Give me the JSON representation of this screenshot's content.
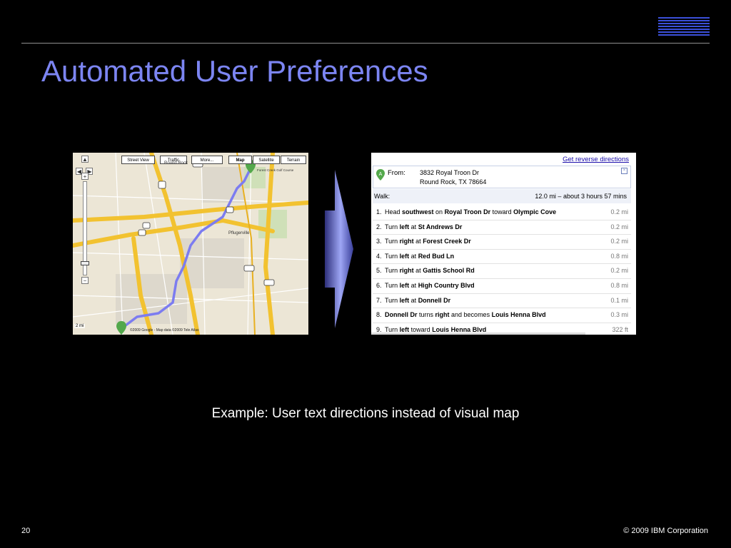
{
  "slide": {
    "title": "Automated User Preferences",
    "caption": "Example:  User text directions instead of visual map",
    "page_number": "20",
    "copyright": "© 2009 IBM Corporation"
  },
  "logo": {
    "text": "IBM",
    "color": "#3b4fd9"
  },
  "map": {
    "buttons": [
      "Street View",
      "Traffic",
      "More...",
      "Map",
      "Satellite",
      "Terrain"
    ],
    "zoom_in": "+",
    "zoom_out": "−",
    "scale": "2 mi",
    "copyright": "©2009 Google - Map data ©2009 Tele Atlas",
    "labels": [
      "Round Rock",
      "Pflugerville",
      "Forest Creek Golf Course"
    ],
    "highway_shields": [
      "79",
      "35",
      "45",
      "1",
      "130",
      "685",
      "45"
    ]
  },
  "directions": {
    "reverse_link": "Get reverse directions",
    "from_label": "From:",
    "address_line1": "3832 Royal Troon Dr",
    "address_line2": "Round Rock, TX 78664",
    "mode_label": "Walk:",
    "summary": "12.0 mi – about 3 hours 57 mins",
    "steps": [
      {
        "num": "1.",
        "pre": "Head ",
        "b1": "southwest",
        "mid": " on ",
        "b2": "Royal Troon Dr",
        "mid2": " toward ",
        "b3": "Olympic Cove",
        "dist": "0.2 mi"
      },
      {
        "num": "2.",
        "pre": "Turn ",
        "b1": "left",
        "mid": " at ",
        "b2": "St Andrews Dr",
        "mid2": "",
        "b3": "",
        "dist": "0.2 mi"
      },
      {
        "num": "3.",
        "pre": "Turn ",
        "b1": "right",
        "mid": " at ",
        "b2": "Forest Creek Dr",
        "mid2": "",
        "b3": "",
        "dist": "0.2 mi"
      },
      {
        "num": "4.",
        "pre": "Turn ",
        "b1": "left",
        "mid": " at ",
        "b2": "Red Bud Ln",
        "mid2": "",
        "b3": "",
        "dist": "0.8 mi"
      },
      {
        "num": "5.",
        "pre": "Turn ",
        "b1": "right",
        "mid": " at ",
        "b2": "Gattis School Rd",
        "mid2": "",
        "b3": "",
        "dist": "0.2 mi"
      },
      {
        "num": "6.",
        "pre": "Turn ",
        "b1": "left",
        "mid": " at ",
        "b2": "High Country Blvd",
        "mid2": "",
        "b3": "",
        "dist": "0.8 mi"
      },
      {
        "num": "7.",
        "pre": "Turn ",
        "b1": "left",
        "mid": " at ",
        "b2": "Donnell Dr",
        "mid2": "",
        "b3": "",
        "dist": "0.1 mi"
      },
      {
        "num": "8.",
        "pre": "",
        "b1": "Donnell Dr",
        "mid": " turns ",
        "b2": "right",
        "mid2": " and becomes ",
        "b3": "Louis Henna Blvd",
        "dist": "0.3 mi"
      },
      {
        "num": "9.",
        "pre": "Turn ",
        "b1": "left",
        "mid": " toward ",
        "b2": "Louis Henna Blvd",
        "mid2": "",
        "b3": "",
        "dist": "322 ft"
      }
    ]
  },
  "colors": {
    "title": "#7c85f2",
    "background": "#000000",
    "route": "#7c7cf0",
    "highway": "#f2c230"
  }
}
